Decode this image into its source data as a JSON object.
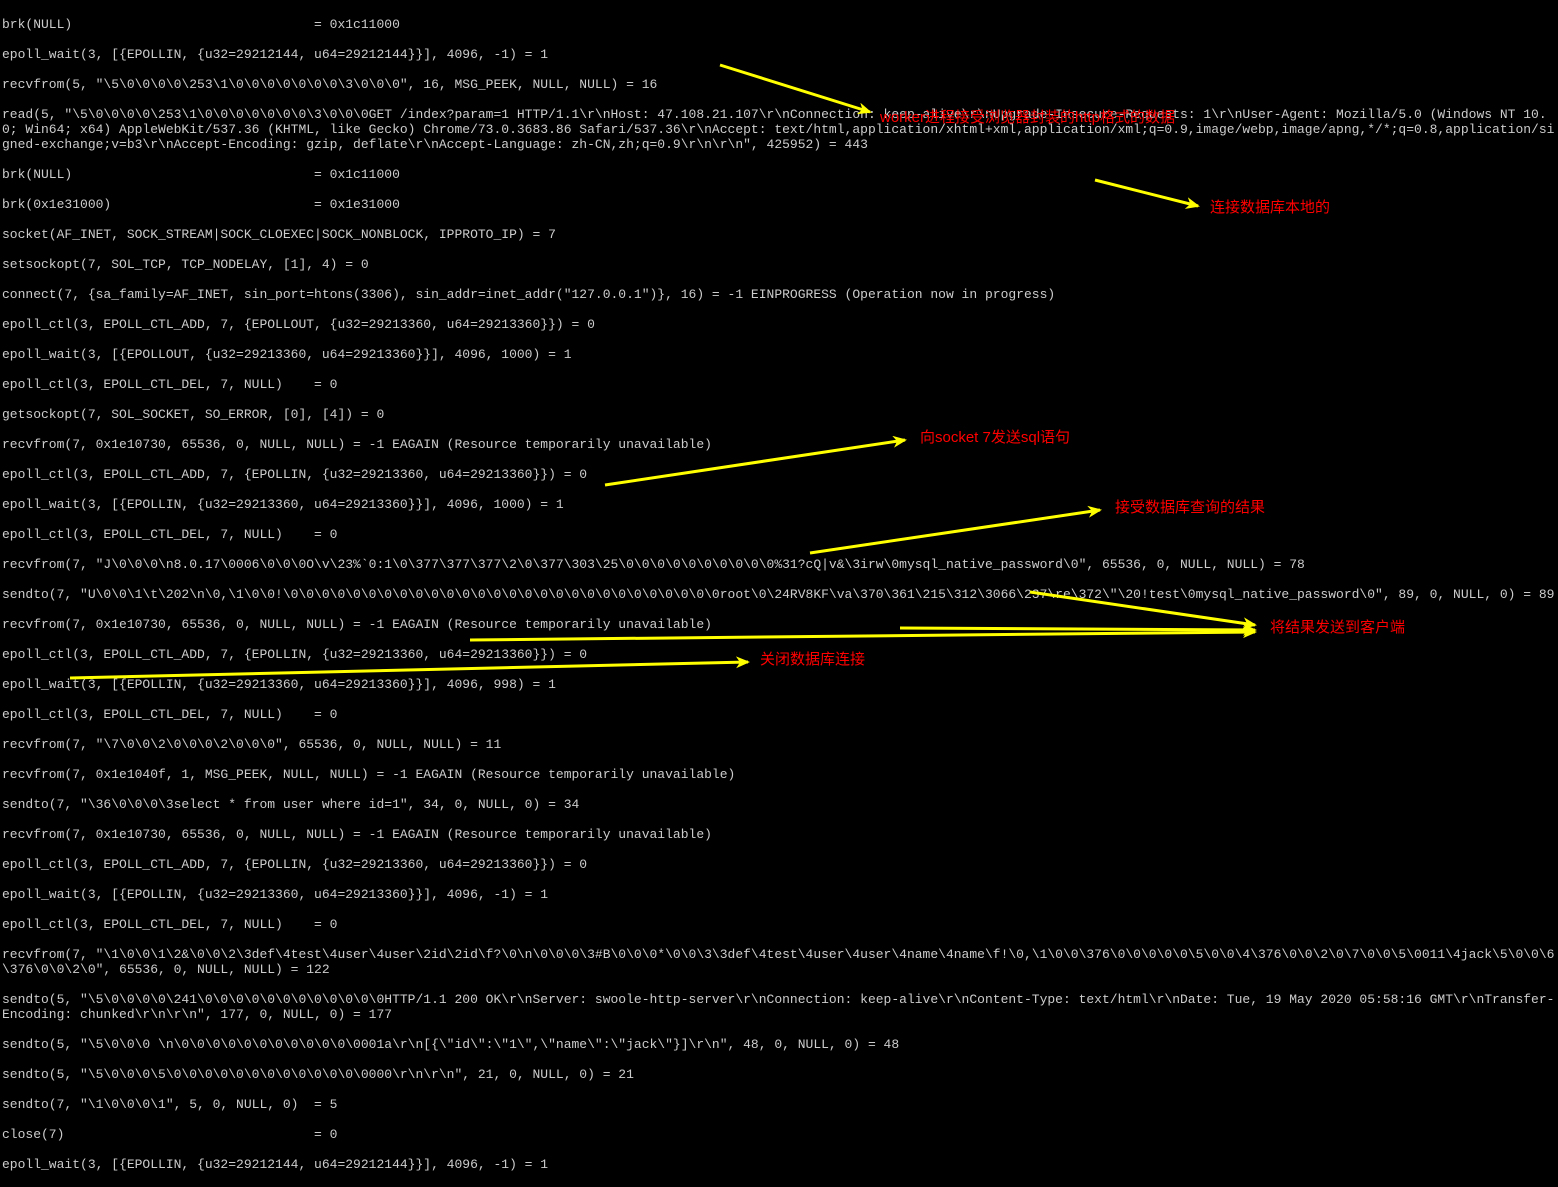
{
  "terminal": {
    "lines": [
      "brk(NULL)                               = 0x1c11000",
      "epoll_wait(3, [{EPOLLIN, {u32=29212144, u64=29212144}}], 4096, -1) = 1",
      "recvfrom(5, \"\\5\\0\\0\\0\\0\\253\\1\\0\\0\\0\\0\\0\\0\\0\\3\\0\\0\\0\", 16, MSG_PEEK, NULL, NULL) = 16",
      "read(5, \"\\5\\0\\0\\0\\0\\253\\1\\0\\0\\0\\0\\0\\0\\0\\3\\0\\0\\0GET /index?param=1 HTTP/1.1\\r\\nHost: 47.108.21.107\\r\\nConnection: keep-alive\\r\\nUpgrade-Insecure-Requests: 1\\r\\nUser-Agent: Mozilla/5.0 (Windows NT 10.0; Win64; x64) AppleWebKit/537.36 (KHTML, like Gecko) Chrome/73.0.3683.86 Safari/537.36\\r\\nAccept: text/html,application/xhtml+xml,application/xml;q=0.9,image/webp,image/apng,*/*;q=0.8,application/signed-exchange;v=b3\\r\\nAccept-Encoding: gzip, deflate\\r\\nAccept-Language: zh-CN,zh;q=0.9\\r\\n\\r\\n\", 425952) = 443",
      "brk(NULL)                               = 0x1c11000",
      "brk(0x1e31000)                          = 0x1e31000",
      "socket(AF_INET, SOCK_STREAM|SOCK_CLOEXEC|SOCK_NONBLOCK, IPPROTO_IP) = 7",
      "setsockopt(7, SOL_TCP, TCP_NODELAY, [1], 4) = 0",
      "connect(7, {sa_family=AF_INET, sin_port=htons(3306), sin_addr=inet_addr(\"127.0.0.1\")}, 16) = -1 EINPROGRESS (Operation now in progress)",
      "epoll_ctl(3, EPOLL_CTL_ADD, 7, {EPOLLOUT, {u32=29213360, u64=29213360}}) = 0",
      "epoll_wait(3, [{EPOLLOUT, {u32=29213360, u64=29213360}}], 4096, 1000) = 1",
      "epoll_ctl(3, EPOLL_CTL_DEL, 7, NULL)    = 0",
      "getsockopt(7, SOL_SOCKET, SO_ERROR, [0], [4]) = 0",
      "recvfrom(7, 0x1e10730, 65536, 0, NULL, NULL) = -1 EAGAIN (Resource temporarily unavailable)",
      "epoll_ctl(3, EPOLL_CTL_ADD, 7, {EPOLLIN, {u32=29213360, u64=29213360}}) = 0",
      "epoll_wait(3, [{EPOLLIN, {u32=29213360, u64=29213360}}], 4096, 1000) = 1",
      "epoll_ctl(3, EPOLL_CTL_DEL, 7, NULL)    = 0",
      "recvfrom(7, \"J\\0\\0\\0\\n8.0.17\\0006\\0\\0\\0O\\v\\23%`0:1\\0\\377\\377\\377\\2\\0\\377\\303\\25\\0\\0\\0\\0\\0\\0\\0\\0\\0\\0%31?cQ|v&\\3irw\\0mysql_native_password\\0\", 65536, 0, NULL, NULL) = 78",
      "sendto(7, \"U\\0\\0\\1\\t\\202\\n\\0,\\1\\0\\0!\\0\\0\\0\\0\\0\\0\\0\\0\\0\\0\\0\\0\\0\\0\\0\\0\\0\\0\\0\\0\\0\\0\\0\\0\\0\\0\\0\\0root\\0\\24RV8KF\\va\\370\\361\\215\\312\\3066\\237\\re\\372\\\"\\20!test\\0mysql_native_password\\0\", 89, 0, NULL, 0) = 89",
      "recvfrom(7, 0x1e10730, 65536, 0, NULL, NULL) = -1 EAGAIN (Resource temporarily unavailable)",
      "epoll_ctl(3, EPOLL_CTL_ADD, 7, {EPOLLIN, {u32=29213360, u64=29213360}}) = 0",
      "epoll_wait(3, [{EPOLLIN, {u32=29213360, u64=29213360}}], 4096, 998) = 1",
      "epoll_ctl(3, EPOLL_CTL_DEL, 7, NULL)    = 0",
      "recvfrom(7, \"\\7\\0\\0\\2\\0\\0\\0\\2\\0\\0\\0\", 65536, 0, NULL, NULL) = 11",
      "recvfrom(7, 0x1e1040f, 1, MSG_PEEK, NULL, NULL) = -1 EAGAIN (Resource temporarily unavailable)",
      "sendto(7, \"\\36\\0\\0\\0\\3select * from user where id=1\", 34, 0, NULL, 0) = 34",
      "recvfrom(7, 0x1e10730, 65536, 0, NULL, NULL) = -1 EAGAIN (Resource temporarily unavailable)",
      "epoll_ctl(3, EPOLL_CTL_ADD, 7, {EPOLLIN, {u32=29213360, u64=29213360}}) = 0",
      "epoll_wait(3, [{EPOLLIN, {u32=29213360, u64=29213360}}], 4096, -1) = 1",
      "epoll_ctl(3, EPOLL_CTL_DEL, 7, NULL)    = 0",
      "recvfrom(7, \"\\1\\0\\0\\1\\2&\\0\\0\\2\\3def\\4test\\4user\\4user\\2id\\2id\\f?\\0\\n\\0\\0\\0\\3#B\\0\\0\\0*\\0\\0\\3\\3def\\4test\\4user\\4user\\4name\\4name\\f!\\0,\\1\\0\\0\\376\\0\\0\\0\\0\\0\\5\\0\\0\\4\\376\\0\\0\\2\\0\\7\\0\\0\\5\\0011\\4jack\\5\\0\\0\\6\\376\\0\\0\\2\\0\", 65536, 0, NULL, NULL) = 122",
      "sendto(5, \"\\5\\0\\0\\0\\0\\241\\0\\0\\0\\0\\0\\0\\0\\0\\0\\0\\0\\0HTTP/1.1 200 OK\\r\\nServer: swoole-http-server\\r\\nConnection: keep-alive\\r\\nContent-Type: text/html\\r\\nDate: Tue, 19 May 2020 05:58:16 GMT\\r\\nTransfer-Encoding: chunked\\r\\n\\r\\n\", 177, 0, NULL, 0) = 177",
      "sendto(5, \"\\5\\0\\0\\0 \\n\\0\\0\\0\\0\\0\\0\\0\\0\\0\\0\\0\\0001a\\r\\n[{\\\"id\\\":\\\"1\\\",\\\"name\\\":\\\"jack\\\"}]\\r\\n\", 48, 0, NULL, 0) = 48",
      "sendto(5, \"\\5\\0\\0\\0\\5\\0\\0\\0\\0\\0\\0\\0\\0\\0\\0\\0\\0\\0000\\r\\n\\r\\n\", 21, 0, NULL, 0) = 21",
      "sendto(7, \"\\1\\0\\0\\0\\1\", 5, 0, NULL, 0)  = 5",
      "close(7)                                = 0",
      "epoll_wait(3, [{EPOLLIN, {u32=29212144, u64=29212144}}], 4096, -1) = 1"
    ]
  },
  "annotations": {
    "http_recv": "worker进程接受浏览器封装的http格式的数据",
    "db_connect": "连接数据库本地的",
    "send_sql": "向socket 7发送sql语句",
    "recv_result": "接受数据库查询的结果",
    "send_client": "将结果发送到客户端",
    "close_db": "关闭数据库连接"
  }
}
